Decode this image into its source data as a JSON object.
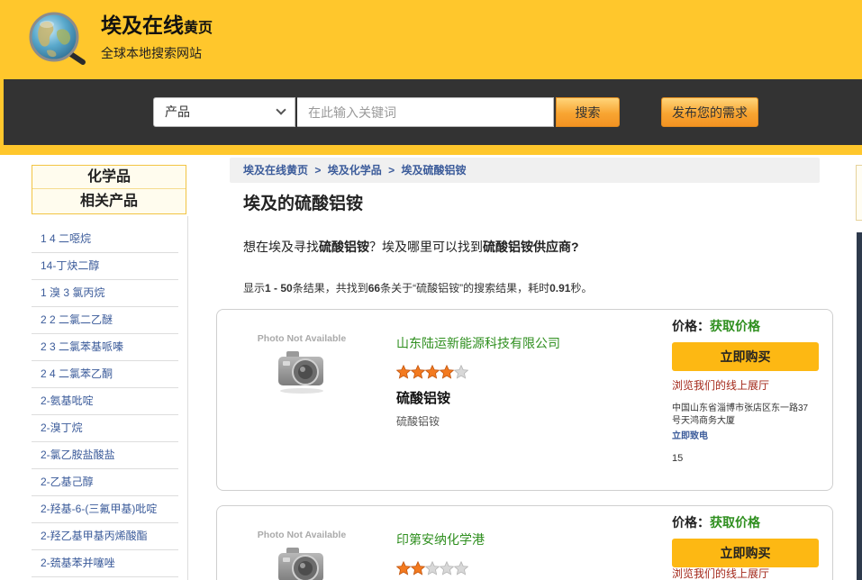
{
  "header": {
    "title_main": "埃及在线",
    "title_suffix": "黄页",
    "subtitle": "全球本地搜索网站"
  },
  "search": {
    "category_selected": "产品",
    "placeholder": "在此输入关键词",
    "button_label": "搜索",
    "post_request_label": "发布您的需求"
  },
  "sidebar": {
    "heading": "化学品",
    "subheading": "相关产品",
    "items": [
      "1 4 二噁烷",
      "14-丁炔二醇",
      "1 溴 3 氯丙烷",
      "2 2 二氯二乙醚",
      "2 3 二氯苯基哌嗪",
      "2 4 二氯苯乙酮",
      "2-氨基吡啶",
      "2-溴丁烷",
      "2-氯乙胺盐酸盐",
      "2-乙基己醇",
      "2-羟基-6-(三氟甲基)吡啶",
      "2-羟乙基甲基丙烯酸酯",
      "2-巯基苯并噻唑"
    ]
  },
  "breadcrumb": {
    "items": [
      "埃及在线黄页",
      "埃及化学品",
      "埃及硫酸铝铵"
    ],
    "separator": ">"
  },
  "page_title": "埃及的硫酸铝铵",
  "question": [
    "想在埃及寻找",
    "硫酸铝铵",
    "？埃及哪里可以找到",
    "硫酸铝铵供应商?"
  ],
  "results_summary": [
    "显示",
    "1 - 50",
    "条结果，共找到",
    "66",
    "条关于“硫酸铝铵”的搜索结果，耗时",
    "0.91",
    "秒。"
  ],
  "listings": [
    {
      "photo_text": "Photo Not Available",
      "company": "山东陆运新能源科技有限公司",
      "rating": 4,
      "rating_max": 5,
      "product": "硫酸铝铵",
      "description": "硫酸铝铵",
      "price_label": "价格：",
      "price_value": "获取价格",
      "buy_label": "立即购买",
      "showroom_label": "浏览我们的线上展厅",
      "address": "中国山东省淄博市张店区东一路37号天鸿商务大厦",
      "call_label": "立即致电",
      "note": "15"
    },
    {
      "photo_text": "Photo Not Available",
      "company": "印第安纳化学港",
      "rating": 2,
      "rating_max": 5,
      "price_label": "价格：",
      "price_value": "获取价格",
      "buy_label": "立即购买",
      "showroom_label": "浏览我们的线上展厅"
    }
  ],
  "icons": {
    "logo": "globe-magnifier-icon",
    "photo_placeholder": "camera-icon",
    "dropdown": "chevron-down-icon",
    "rating": "star-icon"
  },
  "colors": {
    "header-yellow": "#FFC72C",
    "dark-bar": "#333333",
    "link-blue": "#3B5B9A",
    "company-green": "#2F8F1F",
    "buy-yellow": "#FDB813",
    "star-orange": "#F37A1F",
    "showroom-red": "#A3281A",
    "sidebar-border": "#F2C443"
  }
}
